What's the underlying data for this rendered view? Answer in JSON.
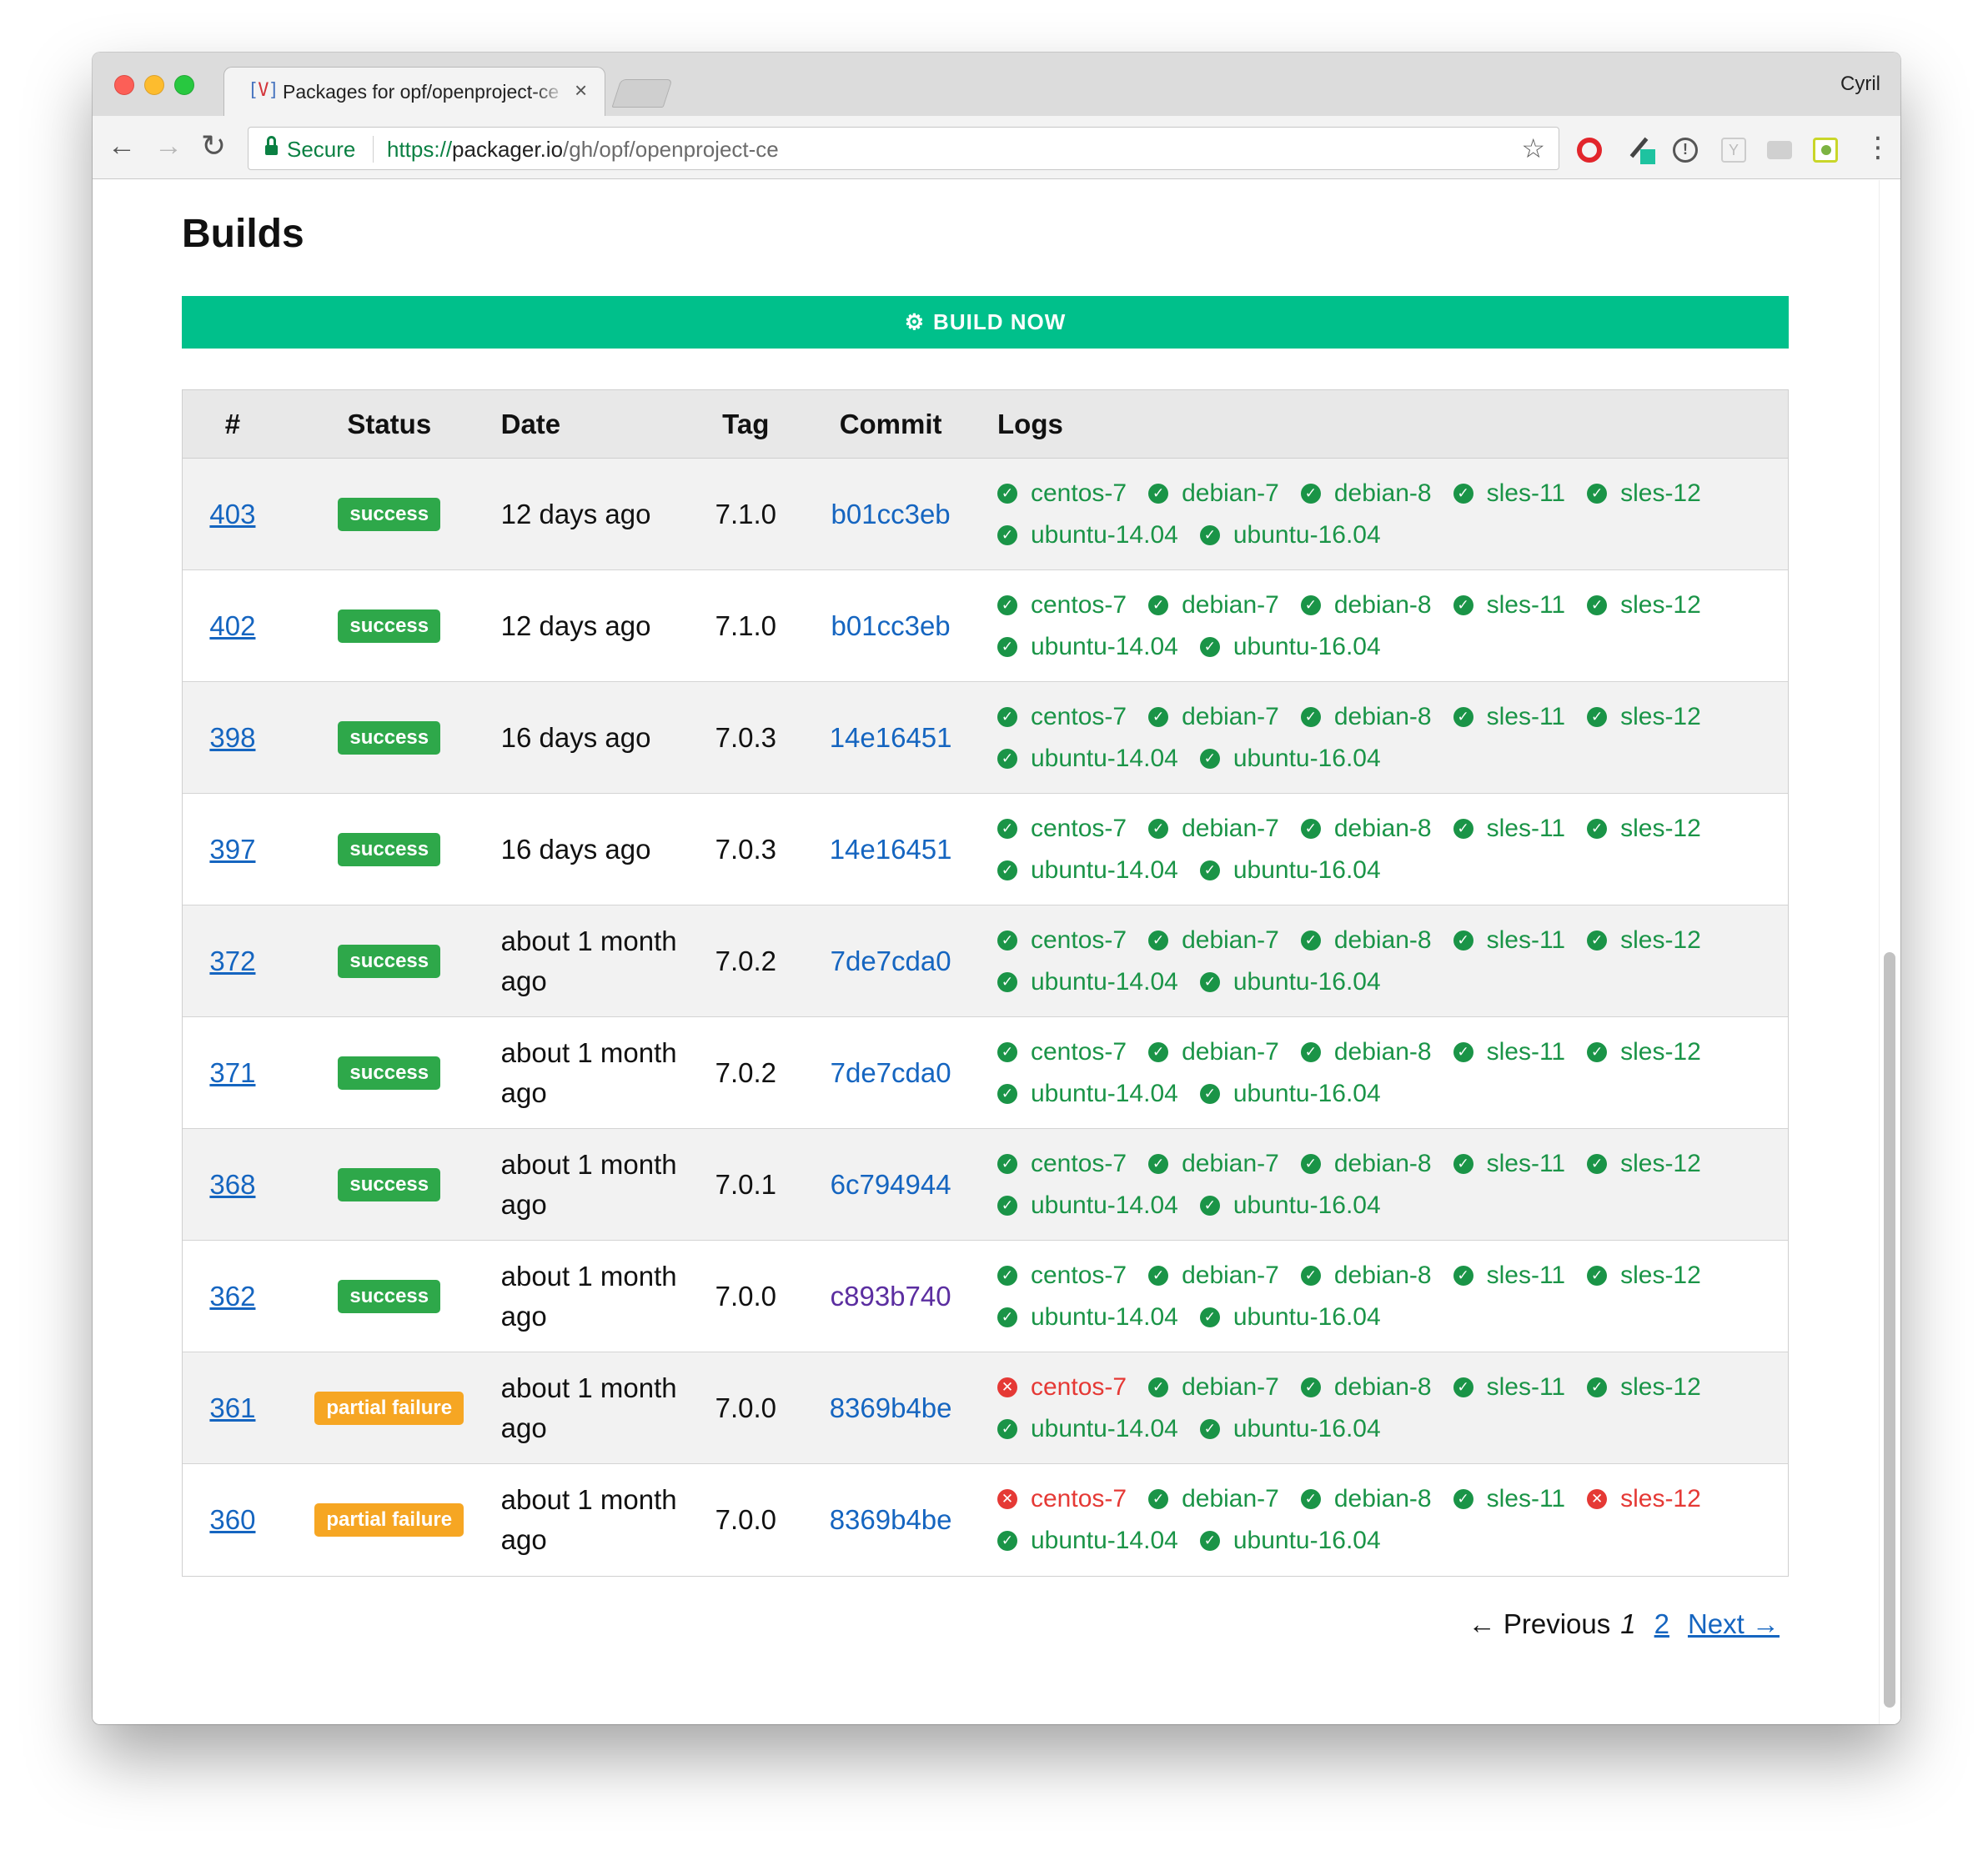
{
  "browser": {
    "tab_title": "Packages for opf/openproject-ce",
    "tab_close": "×",
    "favicon_left": "[",
    "favicon_mid": "V",
    "favicon_right": "]",
    "profile": "Cyril",
    "secure_label": "Secure",
    "url_scheme": "https://",
    "url_host": "packager.io",
    "url_path": "/gh/opf/openproject-ce",
    "icons": {
      "back": "←",
      "forward": "→",
      "reload": "↻",
      "star": "☆",
      "menu": "⋮"
    },
    "colors": {
      "secure": "#0b8043"
    }
  },
  "page": {
    "title": "Builds",
    "build_now_label": "BUILD NOW",
    "build_now_icon": "⚙",
    "accent_color": "#00c08b"
  },
  "table": {
    "headers": [
      "#",
      "Status",
      "Date",
      "Tag",
      "Commit",
      "Logs"
    ],
    "rows": [
      {
        "num": "403",
        "status": "success",
        "date": "12 days ago",
        "tag": "7.1.0",
        "commit": "b01cc3eb",
        "commit_visited": false,
        "logs": [
          {
            "name": "centos-7",
            "ok": true
          },
          {
            "name": "debian-7",
            "ok": true
          },
          {
            "name": "debian-8",
            "ok": true
          },
          {
            "name": "sles-11",
            "ok": true
          },
          {
            "name": "sles-12",
            "ok": true
          },
          {
            "name": "ubuntu-14.04",
            "ok": true
          },
          {
            "name": "ubuntu-16.04",
            "ok": true
          }
        ]
      },
      {
        "num": "402",
        "status": "success",
        "date": "12 days ago",
        "tag": "7.1.0",
        "commit": "b01cc3eb",
        "commit_visited": false,
        "logs": [
          {
            "name": "centos-7",
            "ok": true
          },
          {
            "name": "debian-7",
            "ok": true
          },
          {
            "name": "debian-8",
            "ok": true
          },
          {
            "name": "sles-11",
            "ok": true
          },
          {
            "name": "sles-12",
            "ok": true
          },
          {
            "name": "ubuntu-14.04",
            "ok": true
          },
          {
            "name": "ubuntu-16.04",
            "ok": true
          }
        ]
      },
      {
        "num": "398",
        "status": "success",
        "date": "16 days ago",
        "tag": "7.0.3",
        "commit": "14e16451",
        "commit_visited": false,
        "logs": [
          {
            "name": "centos-7",
            "ok": true
          },
          {
            "name": "debian-7",
            "ok": true
          },
          {
            "name": "debian-8",
            "ok": true
          },
          {
            "name": "sles-11",
            "ok": true
          },
          {
            "name": "sles-12",
            "ok": true
          },
          {
            "name": "ubuntu-14.04",
            "ok": true
          },
          {
            "name": "ubuntu-16.04",
            "ok": true
          }
        ]
      },
      {
        "num": "397",
        "status": "success",
        "date": "16 days ago",
        "tag": "7.0.3",
        "commit": "14e16451",
        "commit_visited": false,
        "logs": [
          {
            "name": "centos-7",
            "ok": true
          },
          {
            "name": "debian-7",
            "ok": true
          },
          {
            "name": "debian-8",
            "ok": true
          },
          {
            "name": "sles-11",
            "ok": true
          },
          {
            "name": "sles-12",
            "ok": true
          },
          {
            "name": "ubuntu-14.04",
            "ok": true
          },
          {
            "name": "ubuntu-16.04",
            "ok": true
          }
        ]
      },
      {
        "num": "372",
        "status": "success",
        "date": "about 1 month ago",
        "tag": "7.0.2",
        "commit": "7de7cda0",
        "commit_visited": false,
        "logs": [
          {
            "name": "centos-7",
            "ok": true
          },
          {
            "name": "debian-7",
            "ok": true
          },
          {
            "name": "debian-8",
            "ok": true
          },
          {
            "name": "sles-11",
            "ok": true
          },
          {
            "name": "sles-12",
            "ok": true
          },
          {
            "name": "ubuntu-14.04",
            "ok": true
          },
          {
            "name": "ubuntu-16.04",
            "ok": true
          }
        ]
      },
      {
        "num": "371",
        "status": "success",
        "date": "about 1 month ago",
        "tag": "7.0.2",
        "commit": "7de7cda0",
        "commit_visited": false,
        "logs": [
          {
            "name": "centos-7",
            "ok": true
          },
          {
            "name": "debian-7",
            "ok": true
          },
          {
            "name": "debian-8",
            "ok": true
          },
          {
            "name": "sles-11",
            "ok": true
          },
          {
            "name": "sles-12",
            "ok": true
          },
          {
            "name": "ubuntu-14.04",
            "ok": true
          },
          {
            "name": "ubuntu-16.04",
            "ok": true
          }
        ]
      },
      {
        "num": "368",
        "status": "success",
        "date": "about 1 month ago",
        "tag": "7.0.1",
        "commit": "6c794944",
        "commit_visited": false,
        "logs": [
          {
            "name": "centos-7",
            "ok": true
          },
          {
            "name": "debian-7",
            "ok": true
          },
          {
            "name": "debian-8",
            "ok": true
          },
          {
            "name": "sles-11",
            "ok": true
          },
          {
            "name": "sles-12",
            "ok": true
          },
          {
            "name": "ubuntu-14.04",
            "ok": true
          },
          {
            "name": "ubuntu-16.04",
            "ok": true
          }
        ]
      },
      {
        "num": "362",
        "status": "success",
        "date": "about 1 month ago",
        "tag": "7.0.0",
        "commit": "c893b740",
        "commit_visited": true,
        "logs": [
          {
            "name": "centos-7",
            "ok": true
          },
          {
            "name": "debian-7",
            "ok": true
          },
          {
            "name": "debian-8",
            "ok": true
          },
          {
            "name": "sles-11",
            "ok": true
          },
          {
            "name": "sles-12",
            "ok": true
          },
          {
            "name": "ubuntu-14.04",
            "ok": true
          },
          {
            "name": "ubuntu-16.04",
            "ok": true
          }
        ]
      },
      {
        "num": "361",
        "status": "partial failure",
        "date": "about 1 month ago",
        "tag": "7.0.0",
        "commit": "8369b4be",
        "commit_visited": false,
        "logs": [
          {
            "name": "centos-7",
            "ok": false
          },
          {
            "name": "debian-7",
            "ok": true
          },
          {
            "name": "debian-8",
            "ok": true
          },
          {
            "name": "sles-11",
            "ok": true
          },
          {
            "name": "sles-12",
            "ok": true
          },
          {
            "name": "ubuntu-14.04",
            "ok": true
          },
          {
            "name": "ubuntu-16.04",
            "ok": true
          }
        ]
      },
      {
        "num": "360",
        "status": "partial failure",
        "date": "about 1 month ago",
        "tag": "7.0.0",
        "commit": "8369b4be",
        "commit_visited": false,
        "logs": [
          {
            "name": "centos-7",
            "ok": false
          },
          {
            "name": "debian-7",
            "ok": true
          },
          {
            "name": "debian-8",
            "ok": true
          },
          {
            "name": "sles-11",
            "ok": true
          },
          {
            "name": "sles-12",
            "ok": false
          },
          {
            "name": "ubuntu-14.04",
            "ok": true
          },
          {
            "name": "ubuntu-16.04",
            "ok": true
          }
        ]
      }
    ],
    "status_colors": {
      "success": "#2ea84a",
      "partial failure": "#f6a623"
    },
    "log_colors": {
      "ok": "#1a9447",
      "fail": "#e53935"
    }
  },
  "pagination": {
    "previous": "← Previous",
    "current": "1",
    "page_2": "2",
    "next": "Next →"
  }
}
